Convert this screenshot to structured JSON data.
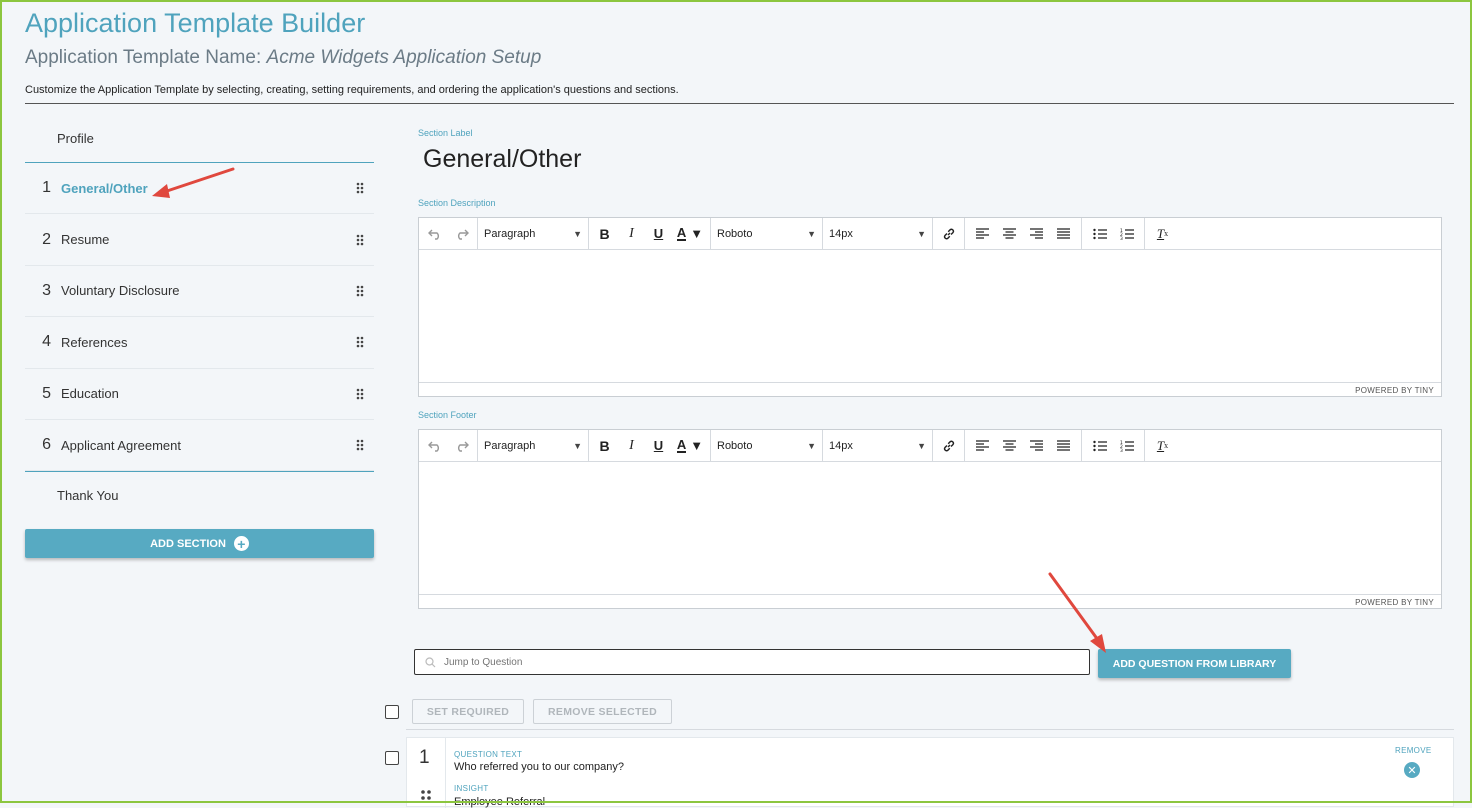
{
  "header": {
    "title": "Application Template Builder",
    "template_name_label": "Application Template Name:",
    "template_name_value": "Acme Widgets Application Setup",
    "subtitle": "Customize the Application Template by selecting, creating, setting requirements, and ordering the application's questions and sections."
  },
  "sidebar": {
    "profile_label": "Profile",
    "items": [
      {
        "num": "1",
        "label": "General/Other",
        "active": true
      },
      {
        "num": "2",
        "label": "Resume"
      },
      {
        "num": "3",
        "label": "Voluntary Disclosure"
      },
      {
        "num": "4",
        "label": "References"
      },
      {
        "num": "5",
        "label": "Education"
      },
      {
        "num": "6",
        "label": "Applicant Agreement"
      }
    ],
    "thankyou_label": "Thank You",
    "add_section_label": "ADD SECTION"
  },
  "main": {
    "section_label_caption": "Section Label",
    "section_label_value": "General/Other",
    "description_caption": "Section Description",
    "footer_caption": "Section Footer",
    "editor": {
      "block_format": "Paragraph",
      "font_family": "Roboto",
      "font_size": "14px",
      "powered_by": "POWERED BY TINY"
    },
    "jump_placeholder": "Jump to Question",
    "add_question_label": "ADD QUESTION FROM LIBRARY",
    "set_required_label": "SET REQUIRED",
    "remove_selected_label": "REMOVE SELECTED",
    "questions": [
      {
        "num": "1",
        "text_caption": "QUESTION TEXT",
        "text": "Who referred you to our company?",
        "insight_caption": "INSIGHT",
        "insight": "Employee Referral",
        "remove_label": "REMOVE"
      }
    ]
  },
  "colors": {
    "accent": "#4fa3bd",
    "button": "#57aac2",
    "frame": "#8cc63f",
    "annotation_arrow": "#e0483e"
  }
}
